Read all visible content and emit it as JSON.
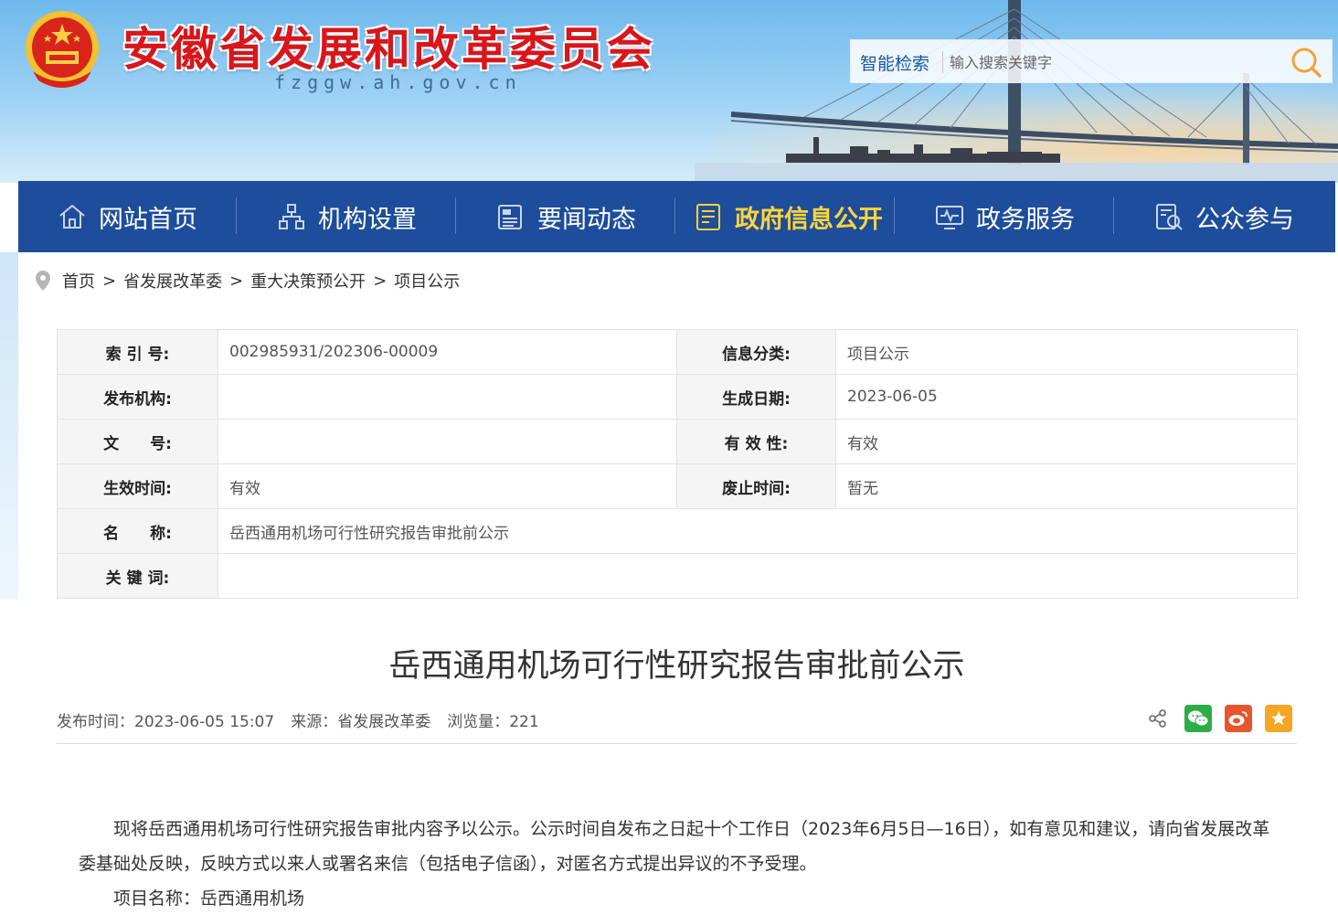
{
  "header": {
    "site_title": "安徽省发展和改革委员会",
    "site_domain": "fzggw.ah.gov.cn",
    "search": {
      "label": "智能检索",
      "placeholder": "输入搜索关键字",
      "button_icon": "search-icon"
    }
  },
  "nav": {
    "items": [
      {
        "label": "网站首页",
        "icon": "home-icon"
      },
      {
        "label": "机构设置",
        "icon": "org-chart-icon"
      },
      {
        "label": "要闻动态",
        "icon": "news-icon"
      },
      {
        "label": "政府信息公开",
        "icon": "document-icon",
        "active": true
      },
      {
        "label": "政务服务",
        "icon": "service-monitor-icon"
      },
      {
        "label": "公众参与",
        "icon": "public-participation-icon"
      }
    ],
    "active_color": "#ffd43b",
    "background": "#1d4d9b"
  },
  "breadcrumb": [
    "首页",
    "省发展改革委",
    "重大决策预公开",
    "项目公示"
  ],
  "breadcrumb_sep": ">",
  "info_table": {
    "index_no_label": "索 引 号:",
    "index_no": "002985931/202306-00009",
    "category_label": "信息分类:",
    "category": "项目公示",
    "publisher_label": "发布机构:",
    "publisher": "",
    "created_label": "生成日期:",
    "created": "2023-06-05",
    "doc_no_label": "文　　号:",
    "doc_no": "",
    "validity_label": "有 效 性:",
    "validity": "有效",
    "effective_label": "生效时间:",
    "effective": "有效",
    "abolish_label": "废止时间:",
    "abolish": "暂无",
    "name_label": "名　　称:",
    "name": "岳西通用机场可行性研究报告审批前公示",
    "keywords_label": "关 键 词:",
    "keywords": ""
  },
  "article": {
    "title": "岳西通用机场可行性研究报告审批前公示",
    "publish_time": "发布时间：2023-06-05 15:07",
    "source": "来源：省发展改革委",
    "views": "浏览量：221",
    "paragraph": "现将岳西通用机场可行性研究报告审批内容予以公示。公示时间自发布之日起十个工作日（2023年6月5日—16日），如有意见和建议，请向省发展改革委基础处反映，反映方式以来人或署名来信（包括电子信函），对匿名方式提出异议的不予受理。",
    "project_name": "项目名称：岳西通用机场"
  },
  "share": {
    "icons": [
      "share-icon",
      "wechat-icon",
      "weibo-icon",
      "favorite-star-icon"
    ],
    "wechat_color": "#2aae45",
    "weibo_color": "#e8542b",
    "favorite_color": "#f5a623"
  }
}
